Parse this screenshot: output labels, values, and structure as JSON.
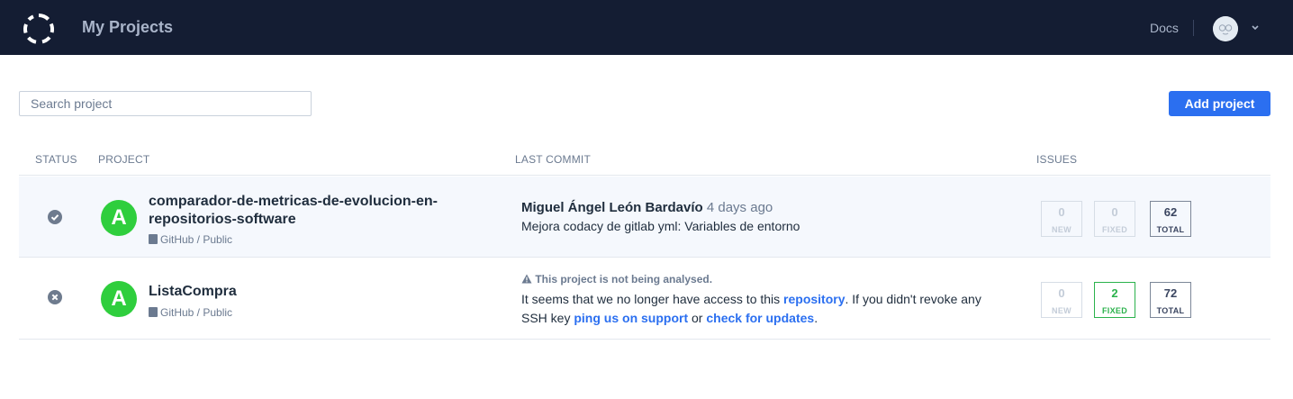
{
  "header": {
    "title": "My Projects",
    "docs_label": "Docs",
    "logo_icon": "codacy-logo-icon",
    "avatar_icon": "user-avatar-icon",
    "caret_icon": "chevron-down-icon"
  },
  "toolbar": {
    "search_placeholder": "Search project",
    "add_label": "Add project"
  },
  "table": {
    "columns": {
      "status": "STATUS",
      "project": "PROJECT",
      "last_commit": "LAST COMMIT",
      "issues": "ISSUES"
    },
    "rows": [
      {
        "status_icon": "check-circle-icon",
        "grade": "A",
        "name": "comparador-de-metricas-de-evolucion-en-repositorios-software",
        "meta": "GitHub / Public",
        "commit_author": "Miguel Ángel León Bardavío",
        "commit_time": "4 days ago",
        "commit_message": "Mejora codacy de gitlab yml: Variables de entorno",
        "issues": {
          "new_value": "0",
          "new_label": "NEW",
          "fixed_value": "0",
          "fixed_label": "FIXED",
          "total_value": "62",
          "total_label": "TOTAL"
        }
      },
      {
        "status_icon": "x-circle-icon",
        "grade": "A",
        "name": "ListaCompra",
        "meta": "GitHub / Public",
        "warning_title": "This project is not being analysed.",
        "warning_text_1": "It seems that we no longer have access to this ",
        "warning_link_1": "repository",
        "warning_text_2": ". If you didn't revoke any SSH key ",
        "warning_link_2": "ping us on support",
        "warning_text_3": " or ",
        "warning_link_3": "check for updates",
        "warning_text_4": ".",
        "issues": {
          "new_value": "0",
          "new_label": "NEW",
          "fixed_value": "2",
          "fixed_label": "FIXED",
          "total_value": "72",
          "total_label": "TOTAL"
        }
      }
    ]
  },
  "colors": {
    "topbar": "#141d33",
    "accent": "#2b6ff0",
    "grade_a": "#2fce3d",
    "fixed_green": "#2bb24c"
  }
}
